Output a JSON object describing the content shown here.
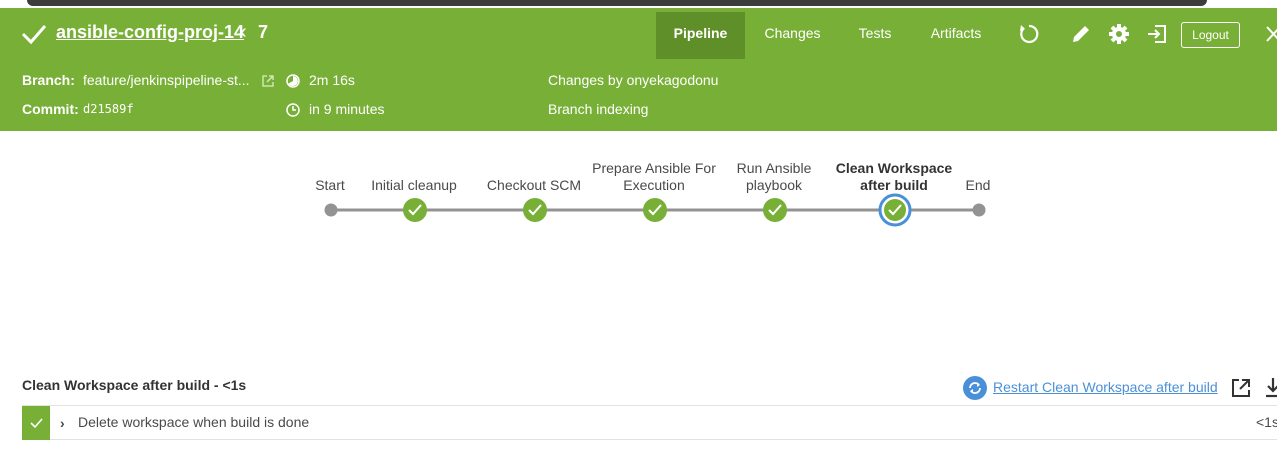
{
  "header": {
    "title": "ansible-config-proj-14",
    "run_number": "7",
    "tabs": [
      {
        "label": "Pipeline",
        "active": true
      },
      {
        "label": "Changes",
        "active": false
      },
      {
        "label": "Tests",
        "active": false
      },
      {
        "label": "Artifacts",
        "active": false
      }
    ],
    "logout_label": "Logout",
    "icons": [
      "rerun-icon",
      "edit-icon",
      "gear-icon",
      "exit-icon",
      "close-icon"
    ],
    "accent_color": "#78b037"
  },
  "info": {
    "branch_label": "Branch:",
    "branch_value": "feature/jenkinspipeline-st...",
    "commit_label": "Commit:",
    "commit_value": "d21589f",
    "duration": "2m 16s",
    "time_ago": "in 9 minutes",
    "changes_by": "Changes by onyekagodonu",
    "cause": "Branch indexing"
  },
  "pipeline": {
    "stages": [
      {
        "label": "Start",
        "status": "node"
      },
      {
        "label": "Initial cleanup",
        "status": "success"
      },
      {
        "label": "Checkout SCM",
        "status": "success"
      },
      {
        "label": "Prepare Ansible For Execution",
        "status": "success"
      },
      {
        "label": "Run Ansible playbook",
        "status": "success"
      },
      {
        "label": "Clean Workspace after build",
        "status": "success",
        "selected": true
      },
      {
        "label": "End",
        "status": "node"
      }
    ]
  },
  "step_detail": {
    "header": "Clean Workspace after build - <1s",
    "restart_label": "Restart Clean Workspace after build",
    "steps": [
      {
        "label": "Delete workspace when build is done",
        "duration": "<1s",
        "status": "success"
      }
    ]
  }
}
